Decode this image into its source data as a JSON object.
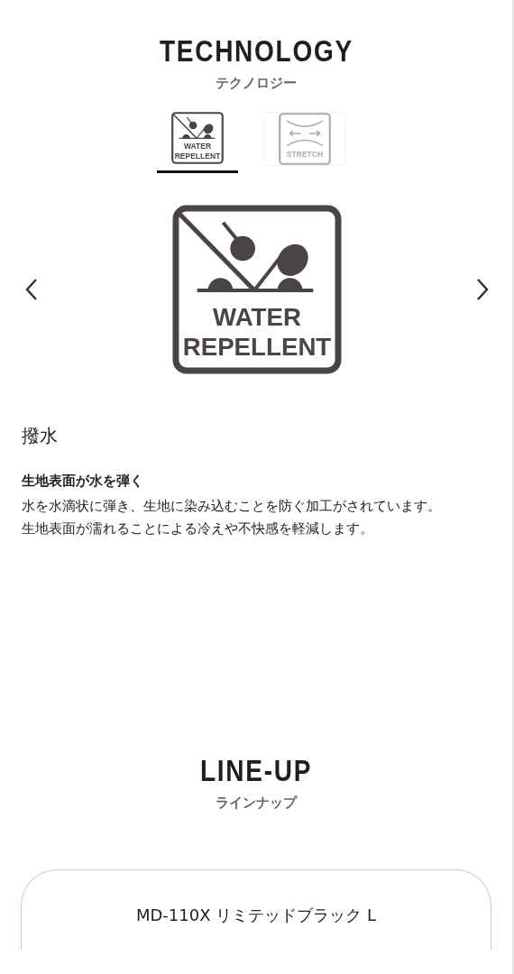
{
  "technology": {
    "title": "TECHNOLOGY",
    "subtitle": "テクノロジー",
    "tabs": [
      {
        "kind": "water",
        "label_lines": [
          "WATER",
          "REPELLENT"
        ],
        "selected": true
      },
      {
        "kind": "stretch",
        "label_lines": [
          "STRETCH"
        ],
        "selected": false
      }
    ],
    "feature": {
      "kind": "water",
      "label_lines": [
        "WATER",
        "REPELLENT"
      ],
      "name": "撥水",
      "heading": "生地表面が水を弾く",
      "body_lines": [
        "水を水滴状に弾き、生地に染み込むことを防ぐ加工がされています。",
        "生地表面が濡れることによる冷えや不快感を軽減します。"
      ]
    }
  },
  "lineup": {
    "title": "LINE-UP",
    "subtitle": "ラインナップ",
    "products": [
      {
        "name": "MD-110X リミテッドブラック L"
      }
    ]
  }
}
